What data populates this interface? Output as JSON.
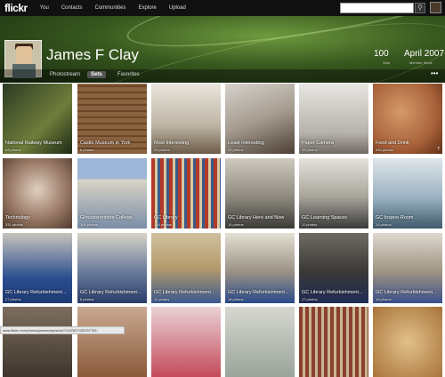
{
  "nav": {
    "logo": "flickr",
    "items": [
      "You",
      "Contacts",
      "Communities",
      "Explore",
      "Upload"
    ]
  },
  "profile": {
    "name": "James F Clay",
    "tabs": [
      "Photostream",
      "Sets",
      "Favorites"
    ],
    "active_tab": 1,
    "stat1_num": "100",
    "stat1_label": "Sets",
    "stat2_num": "April 2007",
    "stat2_label": "Member Since"
  },
  "sets": [
    {
      "title": "National Railway Museum",
      "count": "63 photos",
      "bg": "linear-gradient(135deg,#2c3b22,#6f7d3a 60%,#1d2a16)"
    },
    {
      "title": "Castle Museum in York",
      "count": "8 photos",
      "bg": "repeating-linear-gradient(0deg,#8a6240 0 5px,#6a4628 5px 7px)"
    },
    {
      "title": "Most Interesting",
      "count": "24 photos",
      "bg": "linear-gradient(180deg,#e9e6dd,#bdb4a3 60%,#6d5c48)"
    },
    {
      "title": "Least Interesting",
      "count": "24 photos",
      "bg": "linear-gradient(160deg,#d6d2cc,#a79d91 50%,#4d4036)"
    },
    {
      "title": "Paper Camera",
      "count": "26 photos",
      "bg": "linear-gradient(180deg,#e8e6e2,#b6b2ab 70%,#6f6a62)"
    },
    {
      "title": "Food and Drink",
      "count": "534 photos",
      "bg": "radial-gradient(circle at 40% 40%,#d59a6a,#a9623a 60%,#5e2e16)",
      "comments": "7"
    },
    {
      "title": "Technology",
      "count": "331 photos",
      "bg": "radial-gradient(circle at 50% 45%,#e0cfc0,#9a7a66 55%,#4f3a2e)"
    },
    {
      "title": "Gloucestershire College",
      "count": "108 photos",
      "bg": "linear-gradient(180deg,#9db5d6 0 30%,#d9d4c6 30%,#7a8ea7)"
    },
    {
      "title": "GC Library",
      "count": "164 photos",
      "bg": "repeating-linear-gradient(90deg,#b23a2a 0 4px,#d8c8a0 4px 7px,#3a5a8a 7px 10px)"
    },
    {
      "title": "GC Library Here and Now",
      "count": "14 photos",
      "bg": "linear-gradient(180deg,#cfcac0,#8f8a7e 55%,#3b3a36)"
    },
    {
      "title": "GC Learning Spaces",
      "count": "11 photos",
      "bg": "linear-gradient(180deg,#e4e2dc,#a8a49a 55%,#3a3a3a)"
    },
    {
      "title": "GC Inspire Room",
      "count": "14 photos",
      "bg": "linear-gradient(180deg,#dfe6ea,#9cb3c2 55%,#3f5a6c)"
    },
    {
      "title": "GC Library Refurbishment...",
      "count": "27 photos",
      "bg": "linear-gradient(180deg,#c7c4bc,#2a4d8f 65%,#1d3a73)"
    },
    {
      "title": "GC Library Refurbishment...",
      "count": "8 photos",
      "bg": "linear-gradient(180deg,#d7d3c8,#6a7b9a 55%,#2a3d6a)"
    },
    {
      "title": "GC Library Refurbishment...",
      "count": "11 photos",
      "bg": "linear-gradient(180deg,#cfc1a0,#b59a6a 50%,#3b5a8f)"
    },
    {
      "title": "GC Library Refurbishment...",
      "count": "18 photos",
      "bg": "linear-gradient(180deg,#e4e0d4,#9a9284 55%,#2a4a8a)"
    },
    {
      "title": "GC Library Refurbishment...",
      "count": "17 photos",
      "bg": "linear-gradient(180deg,#6f6b64,#3a3936 55%,#1f2c55)"
    },
    {
      "title": "GC Library Refurbishment...",
      "count": "18 photos",
      "bg": "linear-gradient(180deg,#ddd8cf,#a09482 55%,#3a4f8a)"
    },
    {
      "title": "",
      "count": "",
      "bg": "linear-gradient(180deg,#7d6e5e,#3e352c)"
    },
    {
      "title": "",
      "count": "",
      "bg": "linear-gradient(180deg,#c8a890,#8a5a3a)"
    },
    {
      "title": "",
      "count": "",
      "bg": "linear-gradient(180deg,#ead2d6,#c44a5a)"
    },
    {
      "title": "",
      "count": "",
      "bg": "linear-gradient(180deg,#d6d8d0,#9aa49a)"
    },
    {
      "title": "",
      "count": "",
      "bg": "repeating-linear-gradient(90deg,#8a4030 0 4px,#c8b690 4px 7px)"
    },
    {
      "title": "",
      "count": "",
      "bg": "radial-gradient(circle,#e2c08a,#a8743a)"
    }
  ],
  "status_url": "www.flickr.com/photos/jamesclay/sets/72157627432257751/"
}
